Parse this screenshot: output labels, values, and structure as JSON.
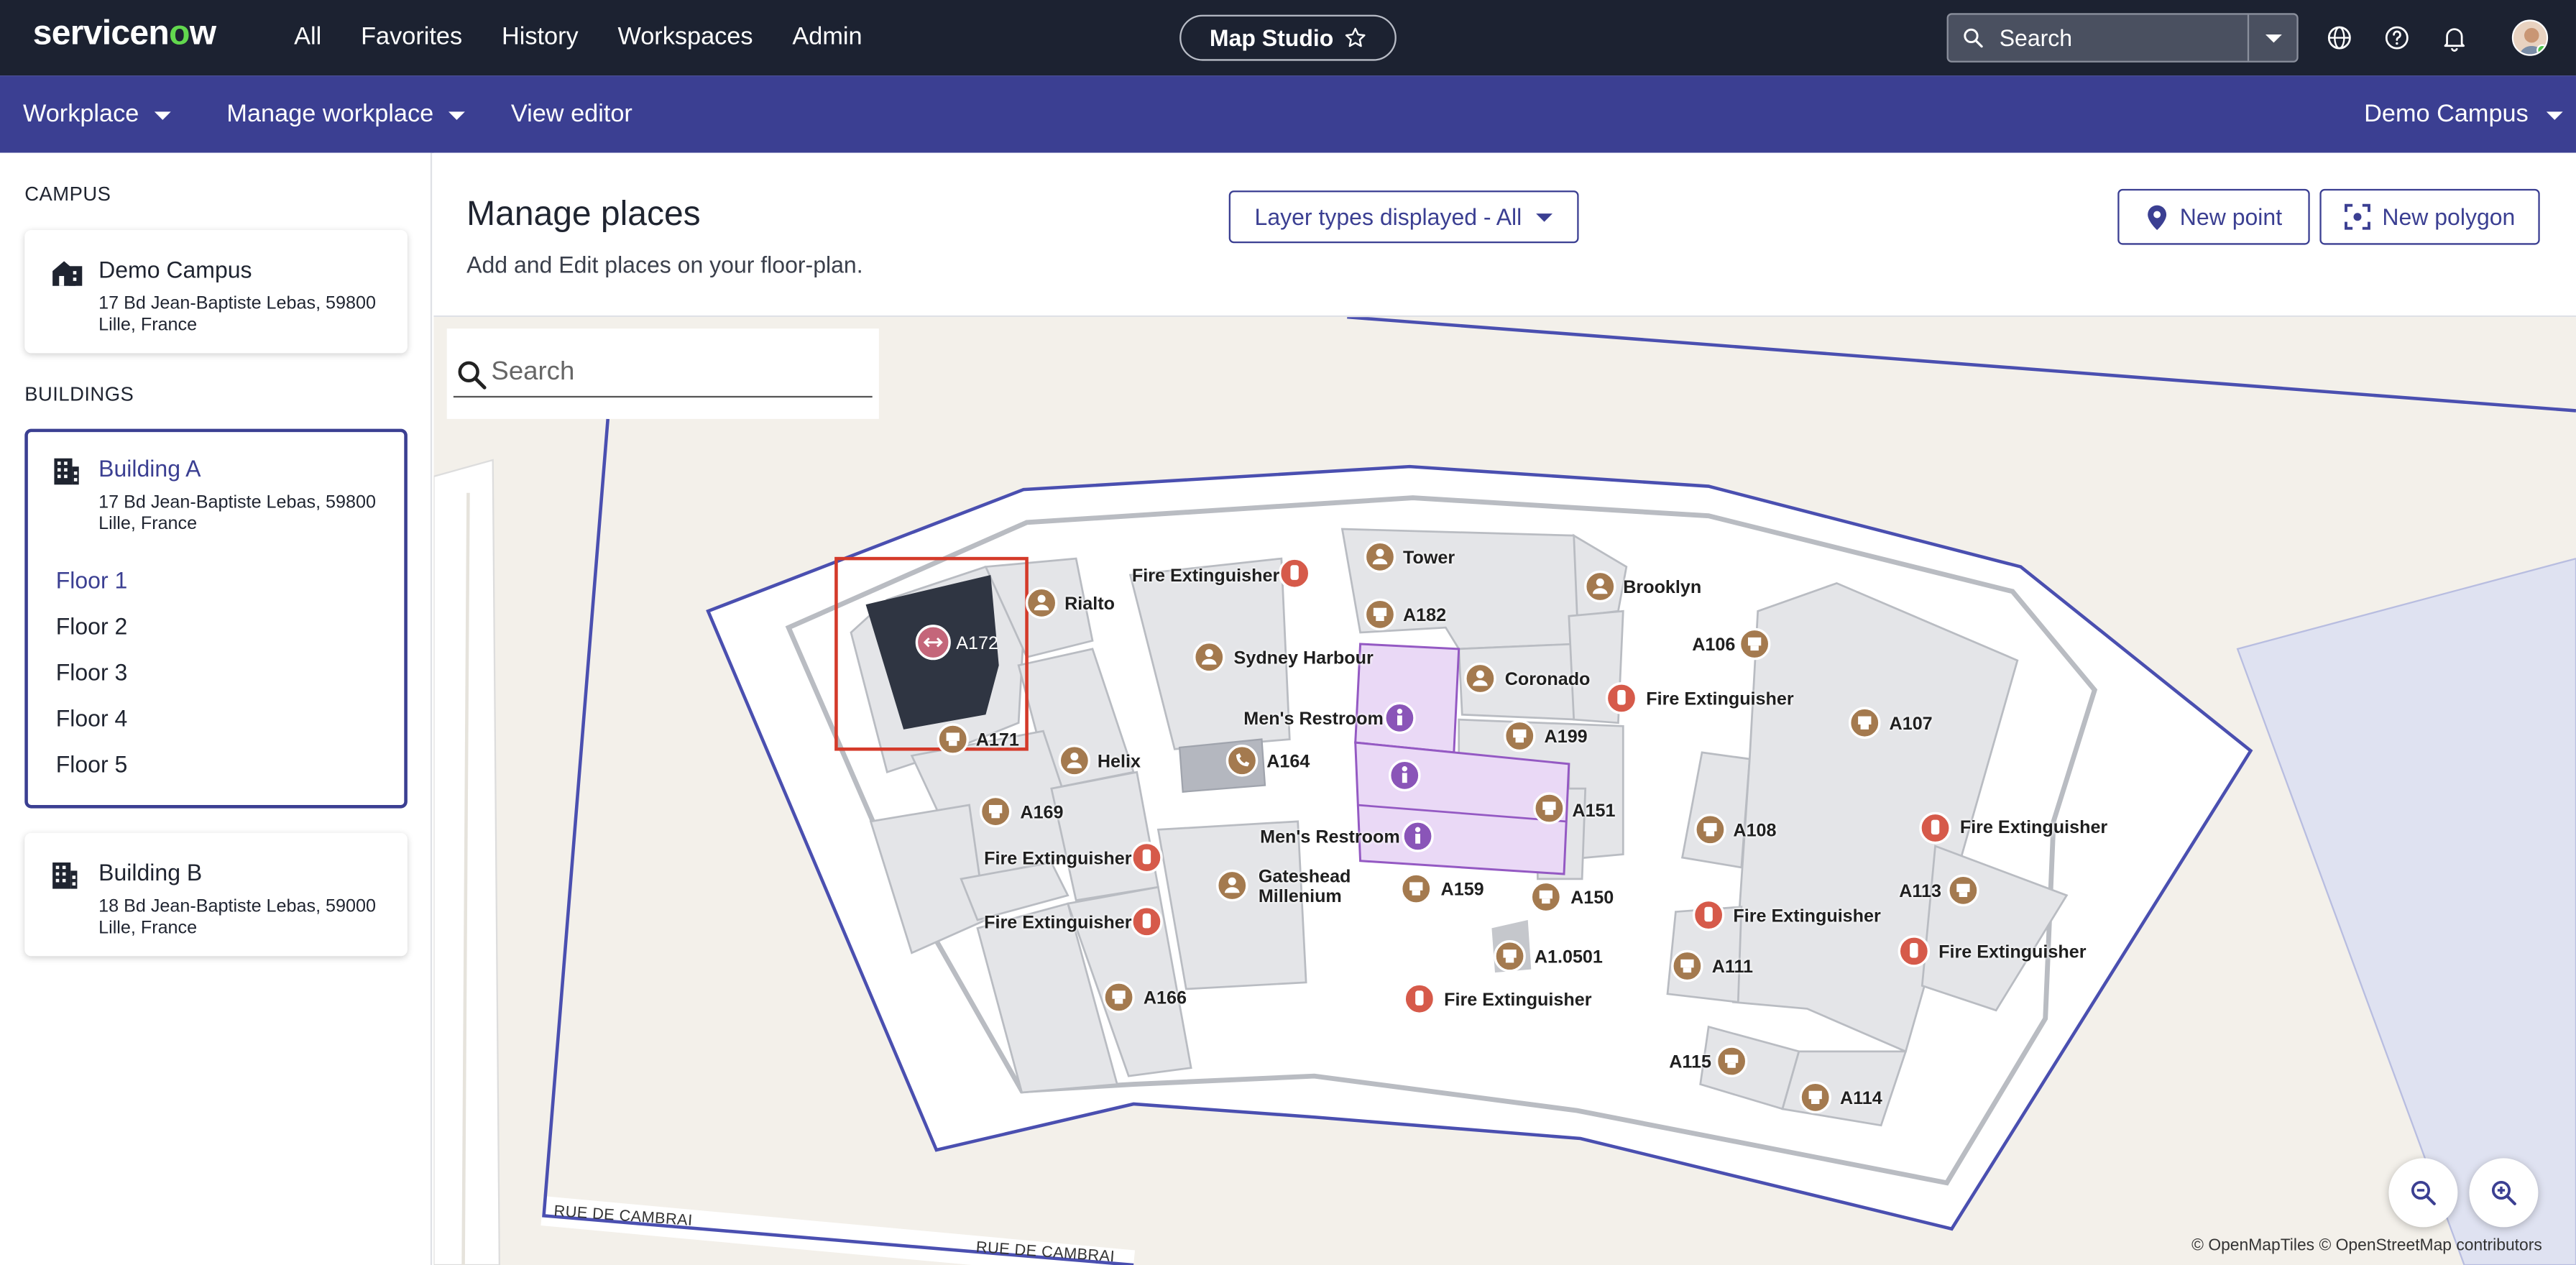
{
  "topbar": {
    "logo_prefix": "servicen",
    "logo_o": "o",
    "logo_suffix": "w",
    "nav": [
      "All",
      "Favorites",
      "History",
      "Workspaces",
      "Admin"
    ],
    "workspace_pill": "Map Studio",
    "search_placeholder": "Search",
    "icons": [
      "globe-icon",
      "help-icon",
      "bell-icon",
      "user-avatar"
    ]
  },
  "subbar": {
    "workplace": "Workplace",
    "manage_workplace": "Manage workplace",
    "view_editor": "View editor",
    "campus_select": "Demo Campus"
  },
  "sidebar": {
    "campus_heading": "CAMPUS",
    "campus": {
      "name": "Demo Campus",
      "address": "17 Bd Jean-Baptiste Lebas, 59800 Lille, France"
    },
    "buildings_heading": "BUILDINGS",
    "buildings": [
      {
        "name": "Building A",
        "address": "17 Bd Jean-Baptiste Lebas, 59800 Lille, France",
        "selected": true
      },
      {
        "name": "Building B",
        "address": "18 Bd Jean-Baptiste Lebas, 59000 Lille, France",
        "selected": false
      }
    ],
    "floors": [
      "Floor 1",
      "Floor 2",
      "Floor 3",
      "Floor 4",
      "Floor 5"
    ],
    "selected_floor": "Floor 1"
  },
  "main": {
    "title": "Manage places",
    "subtitle": "Add and Edit places on your floor-plan.",
    "layer_dropdown": "Layer types displayed - All",
    "new_point": "New point",
    "new_polygon": "New polygon"
  },
  "map": {
    "search_placeholder": "Search",
    "attribution": "© OpenMapTiles © OpenStreetMap contributors",
    "road_1": "RUE DE CAMBRAI",
    "road_2": "RUE DE CAMBRAI",
    "selected_place": "A172",
    "places": [
      {
        "label": "Fire Extinguisher",
        "type": "fire-extinguisher"
      },
      {
        "label": "Tower",
        "type": "meeting-room"
      },
      {
        "label": "Brooklyn",
        "type": "meeting-room"
      },
      {
        "label": "Rialto",
        "type": "meeting-room"
      },
      {
        "label": "A182",
        "type": "desk"
      },
      {
        "label": "A172",
        "type": "selected"
      },
      {
        "label": "A106",
        "type": "desk"
      },
      {
        "label": "Sydney Harbour",
        "type": "meeting-room"
      },
      {
        "label": "Coronado",
        "type": "meeting-room"
      },
      {
        "label": "Fire Extinguisher",
        "type": "fire-extinguisher"
      },
      {
        "label": "Men's Restroom",
        "type": "restroom"
      },
      {
        "label": "A107",
        "type": "desk"
      },
      {
        "label": "A171",
        "type": "desk"
      },
      {
        "label": "A199",
        "type": "desk"
      },
      {
        "label": "Helix",
        "type": "meeting-room"
      },
      {
        "label": "A164",
        "type": "phone-booth"
      },
      {
        "label": "A169",
        "type": "desk"
      },
      {
        "label": "A151",
        "type": "desk"
      },
      {
        "label": "A108",
        "type": "desk"
      },
      {
        "label": "Fire Extinguisher",
        "type": "fire-extinguisher"
      },
      {
        "label": "Men's Restroom",
        "type": "restroom"
      },
      {
        "label": "Fire Extinguisher",
        "type": "fire-extinguisher"
      },
      {
        "label": "Gateshead Millenium",
        "type": "meeting-room"
      },
      {
        "label": "A159",
        "type": "desk"
      },
      {
        "label": "A150",
        "type": "desk"
      },
      {
        "label": "A113",
        "type": "desk"
      },
      {
        "label": "Fire Extinguisher",
        "type": "fire-extinguisher"
      },
      {
        "label": "Fire Extinguisher",
        "type": "fire-extinguisher"
      },
      {
        "label": "Fire Extinguisher",
        "type": "fire-extinguisher"
      },
      {
        "label": "A1.0501",
        "type": "desk"
      },
      {
        "label": "A111",
        "type": "desk"
      },
      {
        "label": "A166",
        "type": "desk"
      },
      {
        "label": "Fire Extinguisher",
        "type": "fire-extinguisher"
      },
      {
        "label": "A115",
        "type": "desk"
      },
      {
        "label": "A114",
        "type": "desk"
      }
    ]
  },
  "colors": {
    "topbar": "#1c2231",
    "subbar": "#3b3f92",
    "accent": "#3b3f92",
    "brand_green": "#62d84e",
    "desk_marker": "#a47a4f",
    "fire_marker": "#d65a4a",
    "restroom_marker": "#8a55b8",
    "restroom_fill": "#ead9f6",
    "selected_room": "#2f3542",
    "selection_box": "#d43a2a"
  }
}
